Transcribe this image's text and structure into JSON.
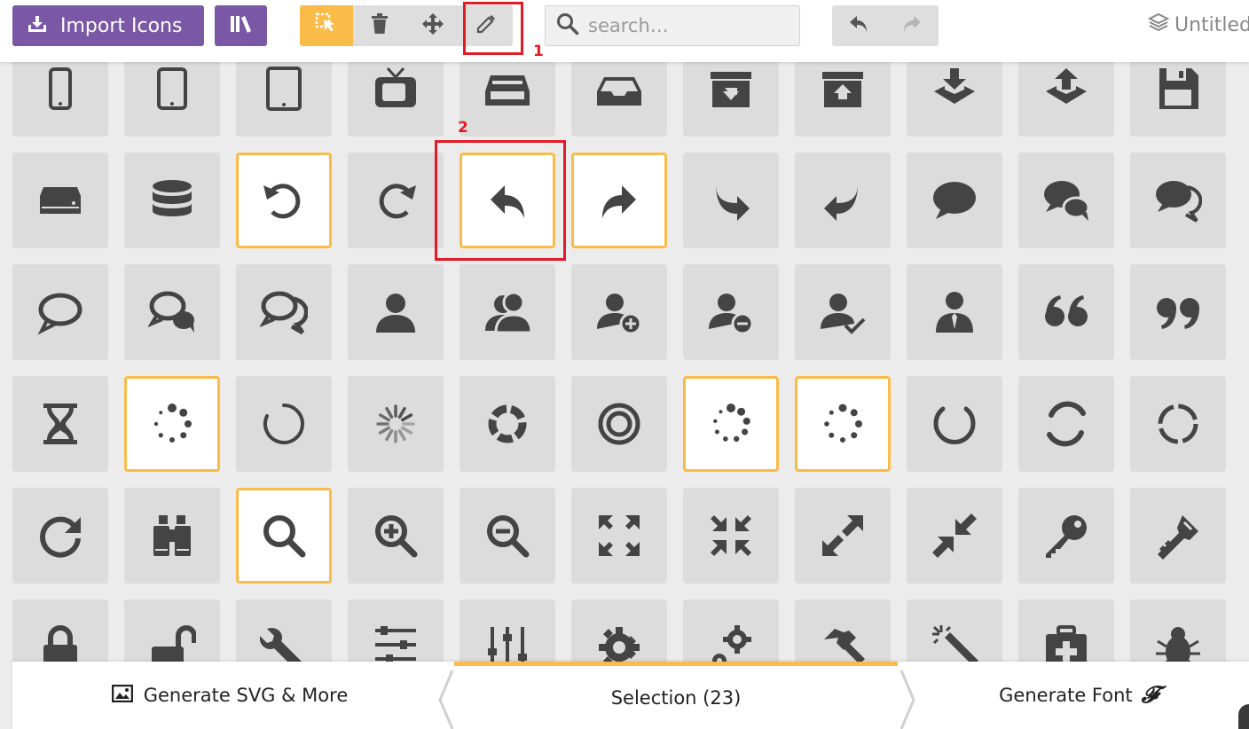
{
  "toolbar": {
    "import_label": "Import Icons",
    "library_icon": "library-books-icon",
    "modes": [
      "select-icon",
      "delete-icon",
      "move-icon",
      "edit-pencil-icon"
    ],
    "active_mode": "select-icon",
    "search_placeholder": "search…",
    "undo_icons": [
      "undo-icon",
      "redo-icon"
    ],
    "project_name": "Untitled"
  },
  "annotations": [
    {
      "label": "1"
    },
    {
      "label": "2"
    }
  ],
  "grid": {
    "rows": [
      [
        "mobile-icon",
        "mobile2-icon",
        "tablet-icon",
        "tv-icon",
        "drawer-icon",
        "drawer2-icon",
        "box-add-icon",
        "box-remove-icon",
        "download-icon",
        "upload-icon",
        "floppy-disk-icon"
      ],
      [
        "drive-icon",
        "database-icon",
        "undo-icon",
        "redo-icon",
        "undo2-icon",
        "redo2-icon",
        "forward-icon",
        "reply-icon",
        "bubble-icon",
        "bubbles-icon",
        "bubbles2-icon"
      ],
      [
        "bubble2-icon",
        "bubbles3-icon",
        "bubbles4-icon",
        "user-icon",
        "users-icon",
        "user-plus-icon",
        "user-minus-icon",
        "user-check-icon",
        "user-tie-icon",
        "quotes-left-icon",
        "quotes-right-icon"
      ],
      [
        "hour-glass-icon",
        "spinner-icon",
        "spinner2-icon",
        "spinner3-icon",
        "spinner4-icon",
        "spinner5-icon",
        "spinner6-icon",
        "spinner7-icon",
        "spinner8-icon",
        "spinner9-icon",
        "spinner10-icon"
      ],
      [
        "spinner11-icon",
        "binoculars-icon",
        "search-icon",
        "zoom-in-icon",
        "zoom-out-icon",
        "enlarge-icon",
        "shrink-icon",
        "enlarge2-icon",
        "shrink2-icon",
        "key-icon",
        "key2-icon"
      ],
      [
        "lock-icon",
        "unlocked-icon",
        "wrench-icon",
        "equalizer-icon",
        "equalizer2-icon",
        "cog-icon",
        "cogs-icon",
        "hammer-icon",
        "magic-wand-icon",
        "aid-kit-icon",
        "bug-icon"
      ]
    ],
    "selected": [
      "undo-icon",
      "redo2-icon",
      "undo2-icon",
      "spinner-icon",
      "spinner6-icon",
      "spinner7-icon",
      "search-icon"
    ]
  },
  "bottom": {
    "generate_svg_label": "Generate SVG & More",
    "selection_label": "Selection (23)",
    "generate_font_label": "Generate Font",
    "font_glyph": "𝓕"
  },
  "colors": {
    "accent": "#fbbb49",
    "brand": "#7a58a6",
    "icon": "#444444",
    "tile": "#dcdcdc",
    "annotation": "#e21b26"
  }
}
